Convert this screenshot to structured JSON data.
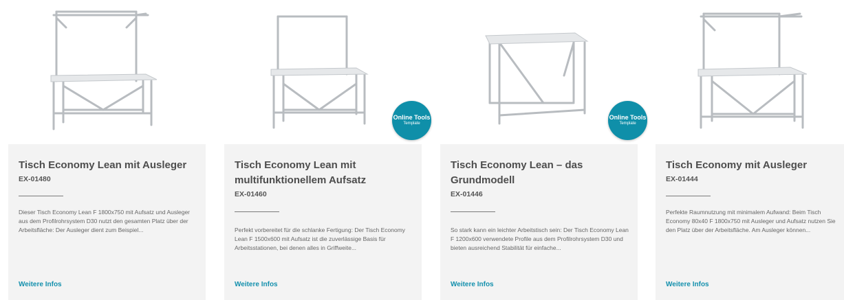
{
  "products": [
    {
      "title": "Tisch Economy Lean mit Ausleger",
      "code": "EX-01480",
      "description": "Dieser Tisch Economy Lean F 1800x750 mit Aufsatz und Ausleger aus dem Profilrohrsystem D30 nutzt den gesamten Platz über der Arbeitsfläche: Der Ausleger dient zum Beispiel...",
      "link": "Weitere Infos",
      "badge": null
    },
    {
      "title": "Tisch Economy Lean mit multifunktionellem Aufsatz",
      "code": "EX-01460",
      "description": "Perfekt vorbereitet für die schlanke Fertigung: Der Tisch Economy Lean F 1500x600 mit Aufsatz ist die zuverlässige Basis für Arbeitsstationen, bei denen alles in Griffweite...",
      "link": "Weitere Infos",
      "badge": {
        "line1": "Online Tools",
        "line2": "Template"
      }
    },
    {
      "title": "Tisch Economy Lean – das Grundmodell",
      "code": "EX-01446",
      "description": "So stark kann ein leichter Arbeitstisch sein: Der Tisch Economy Lean F 1200x600 verwendete Profile aus dem Profilrohrsystem D30 und bieten ausreichend Stabilität für einfache...",
      "link": "Weitere Infos",
      "badge": {
        "line1": "Online Tools",
        "line2": "Template"
      }
    },
    {
      "title": "Tisch Economy mit Ausleger",
      "code": "EX-01444",
      "description": "Perfekte Raumnutzung mit minimalem Aufwand: Beim Tisch Economy 80x40 F 1800x750 mit Ausleger und Aufsatz nutzen Sie den Platz über der Arbeitsfläche. Am Ausleger können...",
      "link": "Weitere Infos",
      "badge": null
    }
  ],
  "colors": {
    "card_bg": "#f3f3f3",
    "title": "#4d4d4d",
    "link": "#1490ad",
    "badge": "#0f8fa9",
    "frame": "#b8bcc0",
    "top": "#e6e8ea"
  },
  "images": [
    "table-with-overhead-boom",
    "table-with-upright-frame",
    "basic-table",
    "table-with-side-boom"
  ]
}
